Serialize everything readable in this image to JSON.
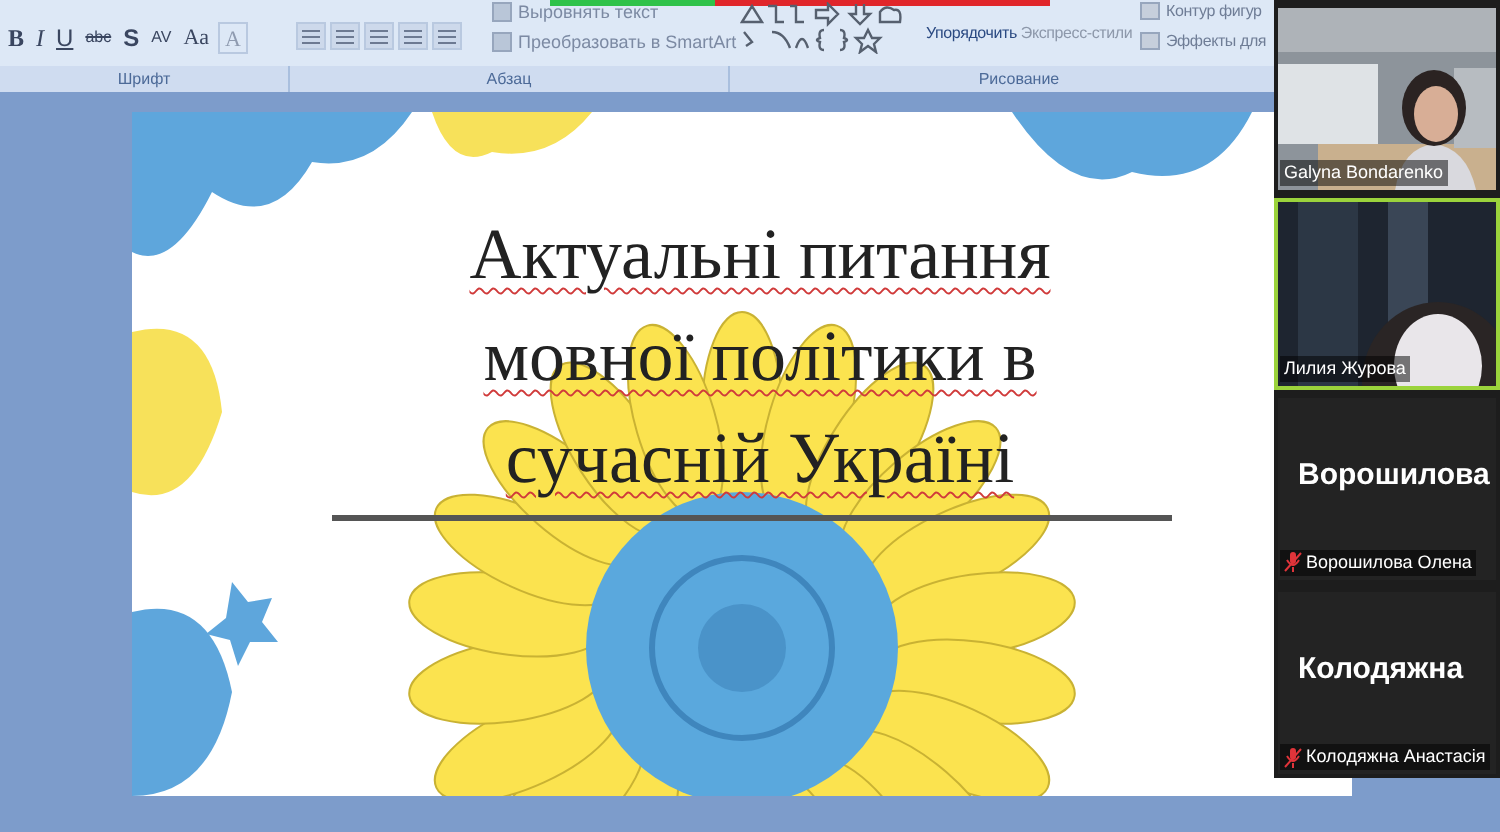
{
  "ribbon": {
    "font_buttons": [
      "B",
      "I",
      "U",
      "abc",
      "S",
      "AV",
      "Aa",
      "A"
    ],
    "paragraph_commands": [
      "Выровнять текст",
      "Преобразовать в SmartArt"
    ],
    "drawing_commands": [
      "Упорядочить",
      "Экспресс-стили"
    ],
    "shape_commands": [
      "Контур фигур",
      "Эффекты для"
    ],
    "groups": [
      "Шрифт",
      "Абзац",
      "Рисование"
    ]
  },
  "slide": {
    "title_lines": [
      "Актуальні питання",
      "мовної політики в",
      "сучасній Україні"
    ]
  },
  "participants": [
    {
      "kind": "video",
      "name": "Galyna Bondarenko",
      "speaking": false,
      "muted": false
    },
    {
      "kind": "video",
      "name": "Лилия Журова",
      "speaking": true,
      "muted": false
    },
    {
      "kind": "name",
      "display": "Ворошилова",
      "name": "Ворошилова Олена",
      "speaking": false,
      "muted": true
    },
    {
      "kind": "name",
      "display": "Колодяжна",
      "name": "Колодяжна Анастасія",
      "speaking": false,
      "muted": true
    }
  ]
}
